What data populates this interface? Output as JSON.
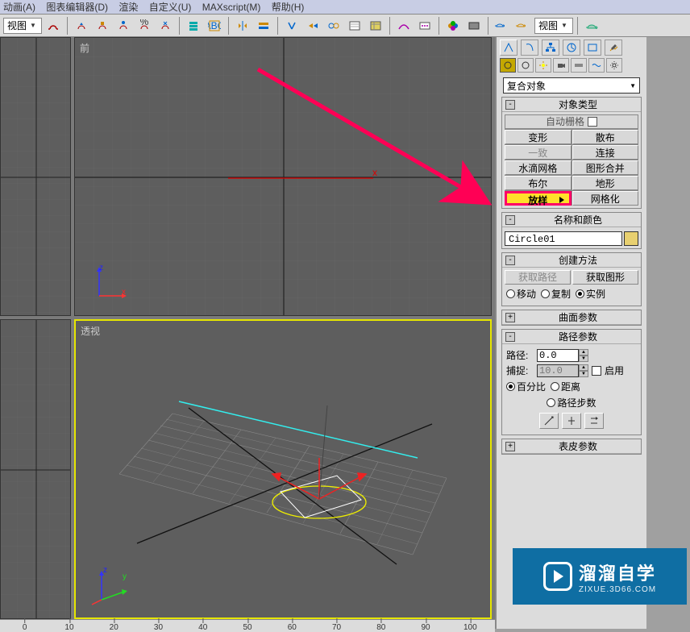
{
  "menu": {
    "items": [
      "动画(A)",
      "图表编辑器(D)",
      "渲染",
      "自定义(U)",
      "MAXscript(M)",
      "帮助(H)"
    ]
  },
  "toolbar": {
    "dropdown1": "视图",
    "dropdown2": "视图"
  },
  "viewports": {
    "front": {
      "label": "前"
    },
    "perspective": {
      "label": "透视"
    },
    "axes": {
      "x": "x",
      "y": "y",
      "z": "z"
    }
  },
  "ruler": {
    "ticks": [
      "0",
      "10",
      "20",
      "30",
      "40",
      "50",
      "60",
      "70",
      "80",
      "90",
      "100"
    ]
  },
  "panel": {
    "compound_dropdown": "复合对象",
    "rollouts": {
      "object_type": {
        "title": "对象类型",
        "auto_grid": "自动栅格",
        "buttons": {
          "morph": "变形",
          "scatter": "散布",
          "conform": "一致",
          "connect": "连接",
          "blobmesh": "水滴网格",
          "shapemerge": "图形合并",
          "boolean": "布尔",
          "terrain": "地形",
          "loft": "放样",
          "mesher": "网格化"
        }
      },
      "name_color": {
        "title": "名称和颜色",
        "name": "Circle01"
      },
      "create_method": {
        "title": "创建方法",
        "get_path": "获取路径",
        "get_shape": "获取图形",
        "move": "移动",
        "copy": "复制",
        "instance": "实例"
      },
      "surface_params": {
        "title": "曲面参数"
      },
      "path_params": {
        "title": "路径参数",
        "path_label": "路径:",
        "path_value": "0.0",
        "snap_label": "捕捉:",
        "snap_value": "10.0",
        "enabled": "启用",
        "percent": "百分比",
        "distance": "距离",
        "path_steps": "路径步数"
      },
      "skin_params": {
        "title": "表皮参数"
      }
    }
  },
  "watermark": {
    "brand": "溜溜自学",
    "url": "ZIXUE.3D66.COM"
  }
}
